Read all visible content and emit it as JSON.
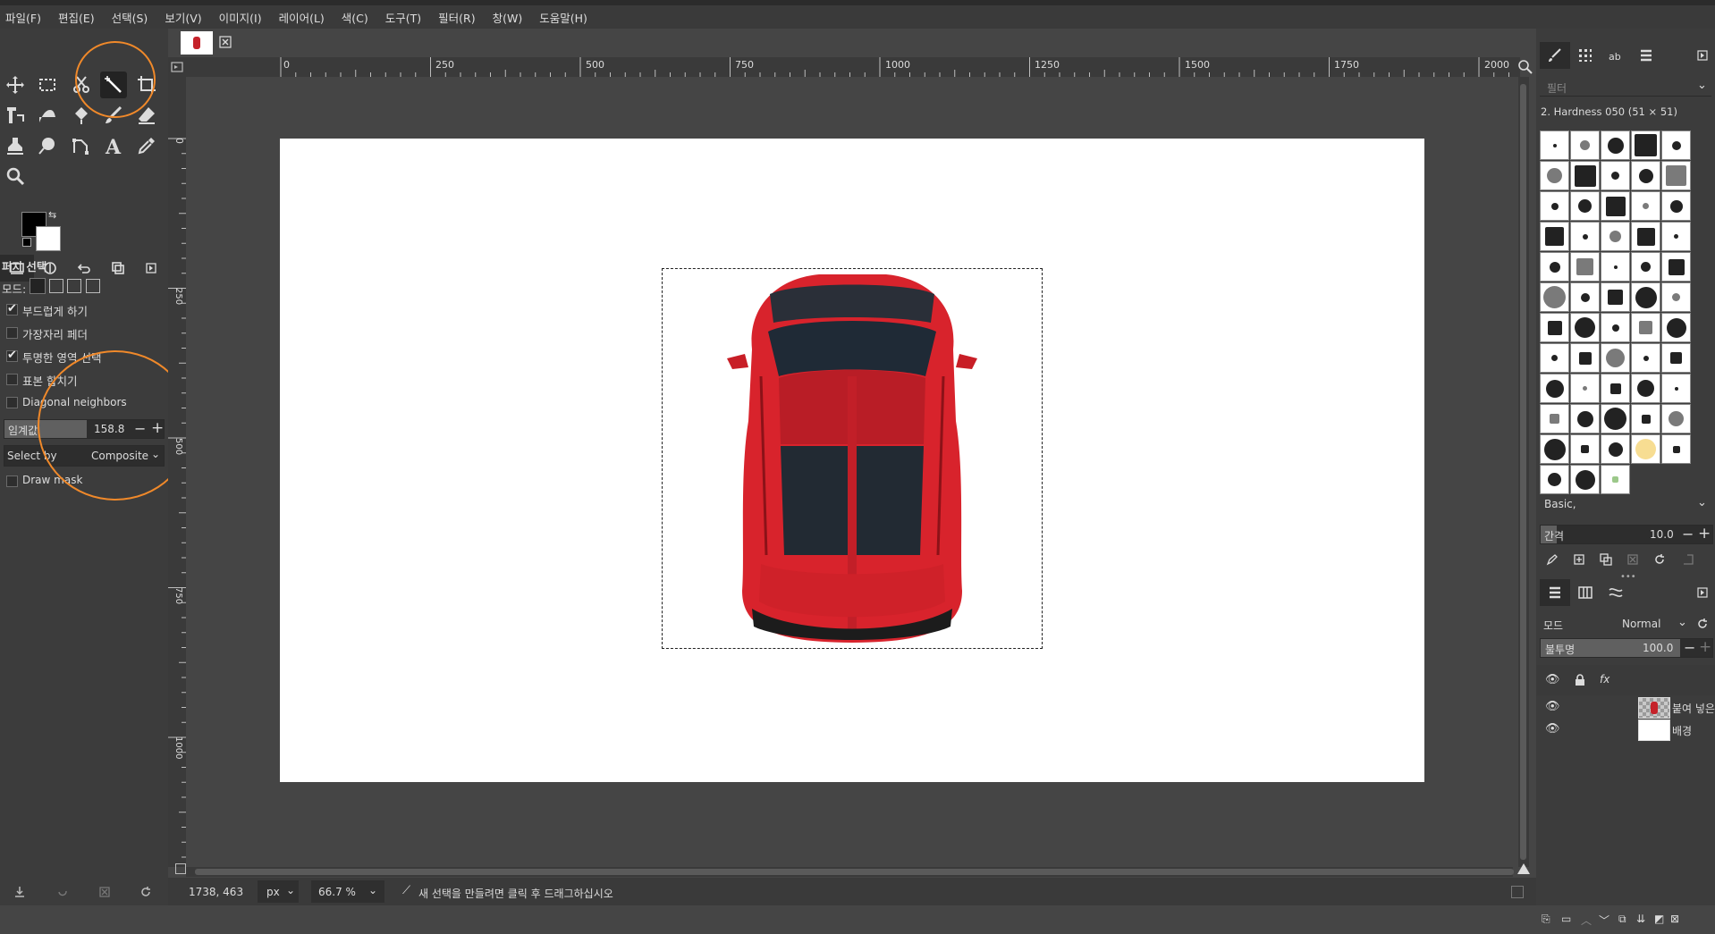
{
  "menu": [
    "파일(F)",
    "편집(E)",
    "선택(S)",
    "보기(V)",
    "이미지(I)",
    "레이어(L)",
    "색(C)",
    "도구(T)",
    "필터(R)",
    "창(W)",
    "도움말(H)"
  ],
  "tool_options": {
    "title": "퍼지 선택",
    "mode_label": "모드:",
    "antialias": "부드럽게 하기",
    "feather": "가장자리 페더",
    "select_transparent": "투명한 영역 선택",
    "sample_merged": "표본 합치기",
    "diagonal": "Diagonal neighbors",
    "threshold_label": "임계값",
    "threshold_value": "158.8",
    "select_by_label": "Select by",
    "select_by_value": "Composite",
    "draw_mask": "Draw mask"
  },
  "ruler": {
    "h": [
      "0",
      "250",
      "500",
      "750",
      "1000",
      "1250",
      "1500",
      "1750",
      "2000"
    ],
    "v": [
      "0",
      "250",
      "500",
      "750",
      "1000"
    ]
  },
  "status": {
    "coords": "1738, 463",
    "unit": "px",
    "zoom": "66.7 %",
    "message": "새 선택을 만들려면 클릭 후 드래그하십시오"
  },
  "brushes": {
    "filter_placeholder": "필터",
    "current": "2. Hardness 050 (51 × 51)",
    "preset": "Basic,",
    "spacing_label": "간격",
    "spacing_value": "10.0"
  },
  "layers": {
    "mode_label": "모드",
    "mode_value": "Normal",
    "opacity_label": "불투명",
    "opacity_value": "100.0",
    "items": [
      "붙여 넣은",
      "배경"
    ]
  },
  "colors": {
    "accent_annotation": "#f0892a",
    "car_red": "#d8232c"
  }
}
